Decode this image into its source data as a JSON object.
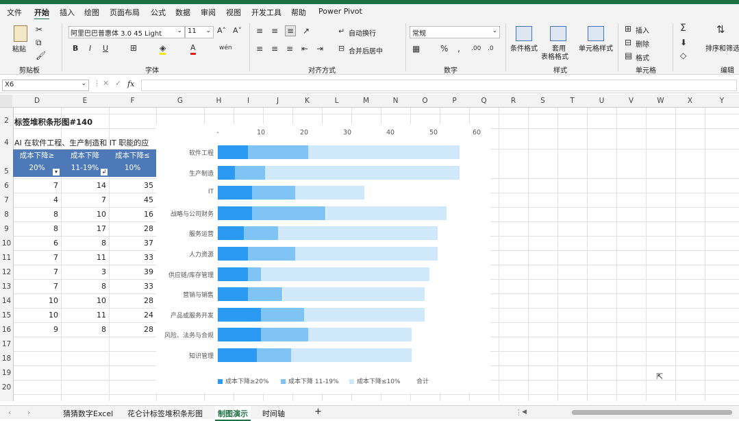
{
  "menu": {
    "items": [
      "文件",
      "开始",
      "插入",
      "绘图",
      "页面布局",
      "公式",
      "数据",
      "审阅",
      "视图",
      "开发工具",
      "帮助",
      "Power Pivot"
    ],
    "active_index": 1
  },
  "ribbon": {
    "paste_label": "粘贴",
    "clipboard_group": "剪贴板",
    "font_name": "阿里巴巴普惠体 3.0 45 Light",
    "font_size": "11",
    "font_group": "字体",
    "bold": "B",
    "italic": "I",
    "underline": "U",
    "wrap_text": "自动换行",
    "merge_center": "合并后居中",
    "alignment_group": "对齐方式",
    "number_format": "常规",
    "number_group": "数字",
    "percent": "%",
    "conditional_format": "条件格式",
    "table_format_line1": "套用",
    "table_format_line2": "表格格式",
    "cell_style": "单元格样式",
    "styles_group": "样式",
    "insert": "插入",
    "delete": "删除",
    "format": "格式",
    "cells_group": "单元格",
    "sort_filter": "排序和筛选",
    "editing_group": "编辑",
    "sum_icon": "Σ"
  },
  "formula_bar": {
    "name_box": "X6",
    "fx": "fx",
    "value": ""
  },
  "columns": [
    "D",
    "E",
    "F",
    "G",
    "H",
    "I",
    "J",
    "K",
    "L",
    "M",
    "N",
    "O",
    "P",
    "Q",
    "R",
    "S",
    "T",
    "U",
    "V",
    "W",
    "X",
    "Y"
  ],
  "rows": [
    "2",
    "4",
    "5",
    "6",
    "7",
    "8",
    "9",
    "10",
    "11",
    "12",
    "13",
    "14",
    "15",
    "16",
    "17",
    "18",
    "19",
    "20"
  ],
  "sheet": {
    "title": "标签堆积条形图#140",
    "subtitle": "AI 在软件工程、生产制造和 IT 职能的应",
    "header_d_line1": "成本下降≥",
    "header_d_line2": "20%",
    "header_e_line1": "成本下降",
    "header_e_line2": "11-19%",
    "header_f_line1": "成本下降≤",
    "header_f_line2": "10%",
    "data": [
      [
        "7",
        "14",
        "35"
      ],
      [
        "4",
        "7",
        "45"
      ],
      [
        "8",
        "10",
        "16"
      ],
      [
        "8",
        "17",
        "28"
      ],
      [
        "6",
        "8",
        "37"
      ],
      [
        "7",
        "11",
        "33"
      ],
      [
        "7",
        "3",
        "39"
      ],
      [
        "7",
        "8",
        "33"
      ],
      [
        "10",
        "10",
        "28"
      ],
      [
        "10",
        "11",
        "24"
      ],
      [
        "9",
        "8",
        "28"
      ]
    ]
  },
  "chart_data": {
    "type": "bar",
    "orientation": "horizontal",
    "stacked": true,
    "categories": [
      "软件工程",
      "生产制造",
      "IT",
      "战略与公司财务",
      "服务运营",
      "人力资源",
      "供应链/库存管理",
      "营销与销售",
      "产品或服务开发",
      "风险、法务与合规",
      "知识管理"
    ],
    "series": [
      {
        "name": "成本下降≥20%",
        "values": [
          7,
          4,
          8,
          8,
          6,
          7,
          7,
          7,
          10,
          10,
          9
        ],
        "color": "#2b9af3"
      },
      {
        "name": "成本下降 11-19%",
        "values": [
          14,
          7,
          10,
          17,
          8,
          11,
          3,
          8,
          10,
          11,
          8
        ],
        "color": "#80c4f6"
      },
      {
        "name": "成本下降≤10%",
        "values": [
          35,
          45,
          16,
          28,
          37,
          33,
          39,
          33,
          28,
          24,
          28
        ],
        "color": "#cfe9fb"
      }
    ],
    "extra_legend": "合计",
    "xlim": [
      0,
      60
    ],
    "xticks": [
      "-",
      "10",
      "20",
      "30",
      "40",
      "50",
      "60"
    ],
    "grid": false,
    "legend_position": "bottom"
  },
  "tabs": {
    "items": [
      "猜猜数字Excel",
      "花仑计标签堆积条形图",
      "制图演示",
      "时间轴"
    ],
    "active_index": 2,
    "add": "+"
  }
}
